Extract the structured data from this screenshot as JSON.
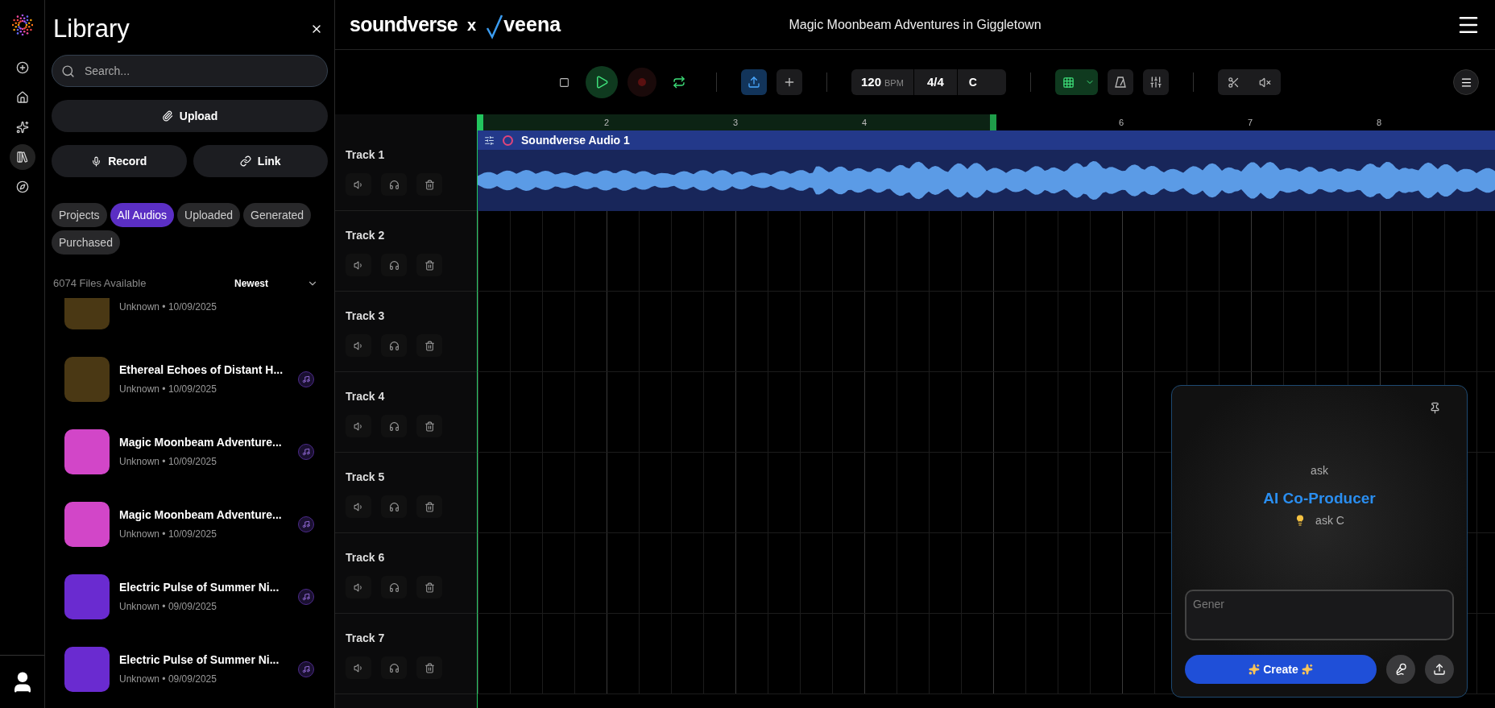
{
  "rail": {
    "items": [
      {
        "kind": "add",
        "selected": false
      },
      {
        "kind": "home",
        "selected": false
      },
      {
        "kind": "create",
        "selected": false
      },
      {
        "kind": "library",
        "selected": true
      },
      {
        "kind": "explore",
        "selected": false
      }
    ]
  },
  "library": {
    "title": "Library",
    "search": {
      "placeholder": "Search..."
    },
    "upload": "Upload",
    "record": "Record",
    "link": "Link",
    "filters": [
      {
        "label": "Projects",
        "selected": false
      },
      {
        "label": "All Audios",
        "selected": true
      },
      {
        "label": "Uploaded",
        "selected": false
      },
      {
        "label": "Generated",
        "selected": false
      },
      {
        "label": "Purchased",
        "selected": false
      }
    ],
    "count": "6074 Files Available",
    "sort": "Newest",
    "items": [
      {
        "meta": "Unknown • 10/09/2025",
        "color": "#4a3814"
      },
      {
        "title": "Ethereal Echoes of Distant H...",
        "meta": "Unknown • 10/09/2025",
        "color": "#4a3814"
      },
      {
        "title": "Magic Moonbeam Adventure...",
        "meta": "Unknown • 10/09/2025",
        "color": "#d246c8"
      },
      {
        "title": "Magic Moonbeam Adventure...",
        "meta": "Unknown • 10/09/2025",
        "color": "#d246c8"
      },
      {
        "title": "Electric Pulse of Summer Ni...",
        "meta": "Unknown • 09/09/2025",
        "color": "#6a2bd0"
      },
      {
        "title": "Electric Pulse of Summer Ni...",
        "meta": "Unknown • 09/09/2025",
        "color": "#6a2bd0"
      }
    ]
  },
  "header": {
    "brand": "soundverse",
    "joiner": "x",
    "partner": "veena",
    "title": "Magic Moonbeam Adventures in Giggletown"
  },
  "toolbar": {
    "bpm": "120",
    "bpm_unit": "BPM",
    "meter": "4/4",
    "key": "C"
  },
  "ruler": {
    "bars": [
      {
        "kind": "marker"
      },
      {
        "kind": "numbered",
        "label": "2"
      },
      {
        "kind": "numbered",
        "label": "3"
      },
      {
        "kind": "numbered",
        "label": "4"
      },
      {
        "kind": "marker"
      },
      {
        "kind": "numbered",
        "label": "6"
      },
      {
        "kind": "numbered",
        "label": "7"
      },
      {
        "kind": "numbered",
        "label": "8"
      }
    ]
  },
  "tracks": [
    {
      "name": "Track 1",
      "clip": {
        "title": "Soundverse Audio 1"
      }
    },
    {
      "name": "Track 2"
    },
    {
      "name": "Track 3"
    },
    {
      "name": "Track 4"
    },
    {
      "name": "Track 5"
    },
    {
      "name": "Track 6"
    },
    {
      "name": "Track 7"
    }
  ],
  "assistant": {
    "prompt_hint": "ask",
    "title": "AI Co-Producer",
    "tip": "ask C",
    "input": {
      "placeholder": "Gener"
    },
    "create": "Create"
  }
}
